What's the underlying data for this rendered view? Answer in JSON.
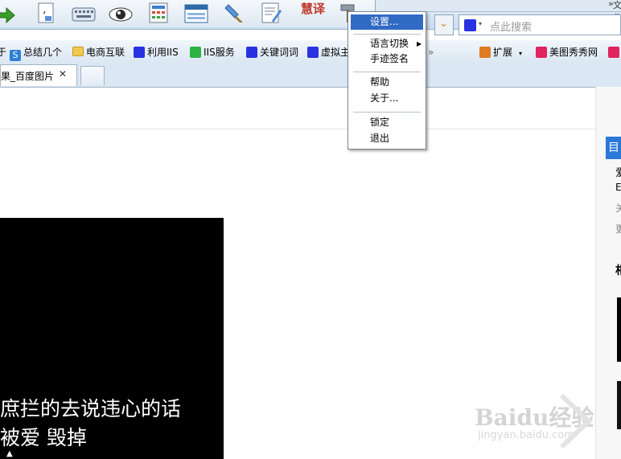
{
  "toolbar": {
    "icons": [
      "download-arrow-icon",
      "document-comma-icon",
      "keyboard-icon",
      "eye-icon",
      "calculator-doc-icon",
      "window-icon",
      "brush-icon",
      "edit-doc-icon",
      "huiyi-translate-icon",
      "hammer-icon"
    ],
    "logo_text": "慧译",
    "right_text": "文件"
  },
  "search": {
    "placeholder": "点此搜索",
    "menu_chevron": "»"
  },
  "bookmarks": [
    {
      "label": "于",
      "icon": "none"
    },
    {
      "label": "总结几个",
      "icon": "s-icon",
      "color": "#2d7fd3"
    },
    {
      "label": "电商互联",
      "icon": "folder-icon",
      "color": "#f2c94c"
    },
    {
      "label": "利用IIS",
      "icon": "baidu-paw-icon",
      "color": "#2932e1"
    },
    {
      "label": "IIS服务",
      "icon": "search-q-icon",
      "color": "#2fb344"
    },
    {
      "label": "关键词词",
      "icon": "baidu-paw-icon",
      "color": "#2932e1"
    },
    {
      "label": "虚拟主",
      "icon": "baidu-paw-icon",
      "color": "#2932e1"
    },
    {
      "label": "»",
      "icon": "none"
    },
    {
      "label": "扩展",
      "icon": "extension-icon",
      "color": "#e07b1f"
    },
    {
      "label": "美图秀秀网",
      "icon": "meitu-icon",
      "color": "#e0245e"
    },
    {
      "label": "",
      "icon": "red-square-icon",
      "color": "#e0245e"
    }
  ],
  "tabs": {
    "active_label": "果_百度图片搜",
    "close_glyph": "✕"
  },
  "content": {
    "lyrics": [
      "庶拦的去说违心的话",
      "被爱 毁掉"
    ],
    "watermark_top": "Baidu经验",
    "watermark_bottom": "jingyan.baidu.com"
  },
  "right_panel": {
    "fragments": [
      "目",
      "爱",
      "E",
      "关",
      "更",
      "相"
    ]
  },
  "context_menu": {
    "items": [
      {
        "label": "设置...",
        "highlighted": true
      },
      {
        "label": "语言切换",
        "submenu": true
      },
      {
        "label": "手迹签名"
      },
      {
        "label": "帮助"
      },
      {
        "label": "关于..."
      },
      {
        "label": "锁定"
      },
      {
        "label": "退出"
      }
    ]
  },
  "colors": {
    "menu_highlight": "#316ac5",
    "toolbar_bg": "#c9dcee"
  }
}
